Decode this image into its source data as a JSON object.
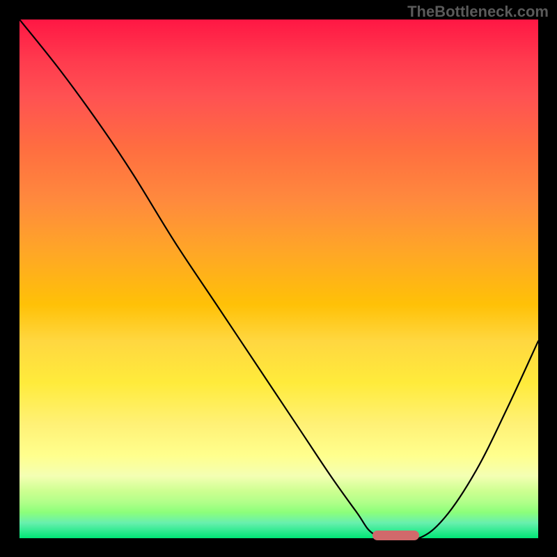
{
  "watermark": "TheBottleneck.com",
  "chart_data": {
    "type": "line",
    "title": "",
    "xlabel": "",
    "ylabel": "",
    "xlim": [
      0,
      100
    ],
    "ylim": [
      0,
      100
    ],
    "legend": false,
    "grid": false,
    "annotations": [],
    "series": [
      {
        "name": "curve",
        "x": [
          0,
          8,
          16,
          22,
          30,
          38,
          46,
          54,
          60,
          65,
          68,
          72,
          77,
          82,
          88,
          94,
          100
        ],
        "y": [
          100,
          90,
          79,
          70,
          57,
          45,
          33,
          21,
          12,
          5,
          1,
          0,
          0,
          4,
          13,
          25,
          38
        ]
      }
    ],
    "optimal_range": {
      "x_start": 68,
      "x_end": 77,
      "y": 0
    },
    "background_gradient": {
      "type": "vertical",
      "stops": [
        {
          "pos": 0,
          "color": "#ff1744"
        },
        {
          "pos": 15,
          "color": "#ff5252"
        },
        {
          "pos": 35,
          "color": "#ff8a3d"
        },
        {
          "pos": 55,
          "color": "#ffc107"
        },
        {
          "pos": 70,
          "color": "#ffeb3b"
        },
        {
          "pos": 88,
          "color": "#f4ffb3"
        },
        {
          "pos": 100,
          "color": "#00e676"
        }
      ]
    }
  }
}
